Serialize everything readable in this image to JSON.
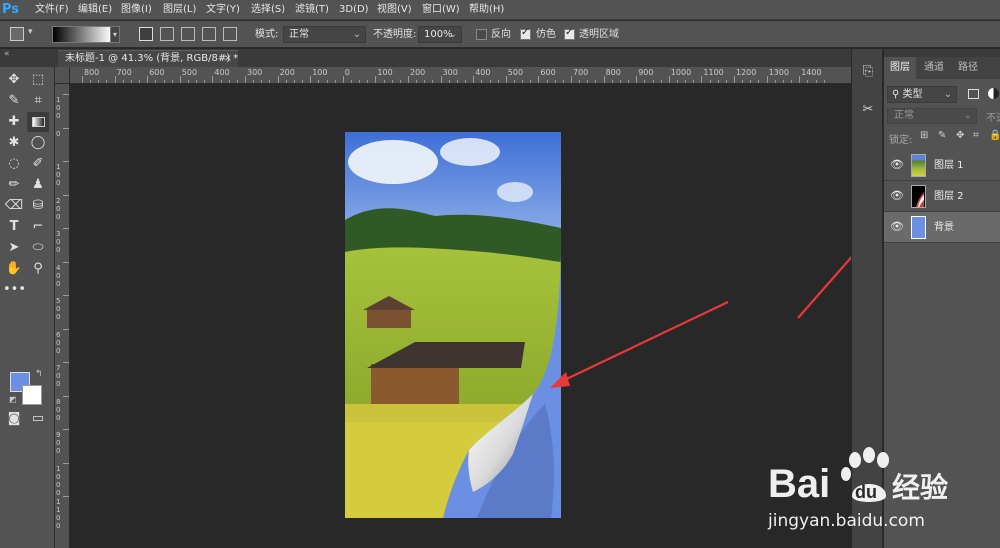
{
  "app": {
    "logo": "Ps"
  },
  "menu": [
    "文件(F)",
    "编辑(E)",
    "图像(I)",
    "图层(L)",
    "文字(Y)",
    "选择(S)",
    "滤镜(T)",
    "3D(D)",
    "视图(V)",
    "窗口(W)",
    "帮助(H)"
  ],
  "options": {
    "mode_label": "模式:",
    "mode_value": "正常",
    "opacity_label": "不透明度:",
    "opacity_value": "100%",
    "reverse_label": "反向",
    "dither_label": "仿色",
    "transparency_label": "透明区域",
    "reverse_checked": false,
    "dither_checked": true,
    "transparency_checked": true
  },
  "document": {
    "tab_title": "未标题-1 @ 41.3% (背景, RGB/8#) *",
    "close": "×"
  },
  "ruler": {
    "top_labels": [
      "800",
      "700",
      "600",
      "500",
      "400",
      "300",
      "200",
      "100",
      "0",
      "100",
      "200",
      "300",
      "400",
      "500",
      "600",
      "700",
      "800",
      "900",
      "1000",
      "1100",
      "1200",
      "1300",
      "1400"
    ],
    "left_labels": [
      "100",
      "0",
      "100",
      "200",
      "300",
      "400",
      "500",
      "600",
      "700",
      "800",
      "900",
      "1000",
      "1100"
    ]
  },
  "colors": {
    "foreground": "#6b8fe3",
    "background": "#ffffff",
    "canvas_fill": "#6b8fe3",
    "annotation_arrow": "#e8393a"
  },
  "panel": {
    "tabs": [
      "图层",
      "通道",
      "路径"
    ],
    "filter_kind": "类型",
    "blend_mode": "正常",
    "opacity_short": "不透",
    "lock_label": "锁定:",
    "layers": [
      {
        "name": "图层 1",
        "visible": true,
        "selected": false,
        "thumb": "landscape"
      },
      {
        "name": "图层 2",
        "visible": true,
        "selected": false,
        "thumb": "curl-mask"
      },
      {
        "name": "背景",
        "visible": true,
        "selected": true,
        "thumb": "blue-fill"
      }
    ]
  },
  "watermark": {
    "brand": "Bai",
    "brand_tail": "du",
    "cn": "经验",
    "url": "jingyan.baidu.com"
  }
}
